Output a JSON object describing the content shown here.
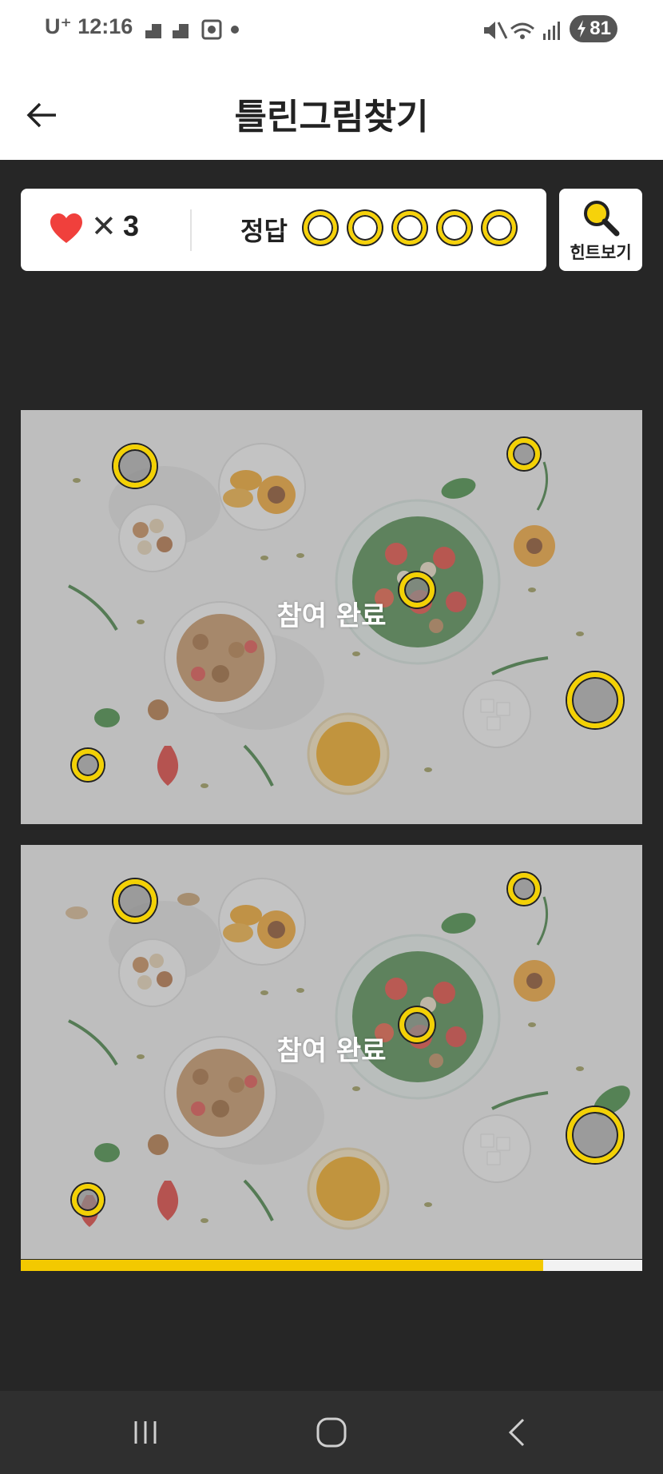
{
  "status_bar": {
    "carrier": "U⁺",
    "time": "12:16",
    "battery": "81",
    "icons": [
      "mute-icon",
      "wifi-icon",
      "signal-icon",
      "battery-icon"
    ]
  },
  "app_bar": {
    "title": "틀린그림찾기",
    "back_icon": "arrow-left-icon"
  },
  "game_status": {
    "lives_symbol": "✕",
    "lives": "3",
    "answer_label": "정답",
    "answers_total": 5,
    "answers_found": 5,
    "hint_label": "힌트보기",
    "hint_icon": "magnifier-icon"
  },
  "puzzle": {
    "top_overlay_text": "참여 완료",
    "bottom_overlay_text": "참여 완료",
    "found_differences": 5
  },
  "progress": {
    "fraction": 0.84
  },
  "colors": {
    "accent_yellow": "#f6d20b",
    "heart_red": "#f0403c",
    "background_dark": "#262626"
  },
  "nav_bar": {
    "buttons": [
      "recent-apps-icon",
      "home-icon",
      "back-icon"
    ]
  }
}
